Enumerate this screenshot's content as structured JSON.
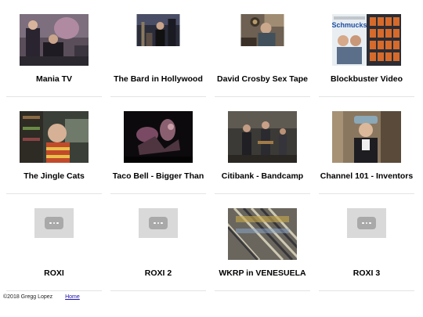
{
  "videos": [
    {
      "title": "Mania TV",
      "thumb": "photo"
    },
    {
      "title": "The Bard in Hollywood",
      "thumb": "photo"
    },
    {
      "title": "David Crosby Sex Tape",
      "thumb": "photo"
    },
    {
      "title": "Blockbuster Video",
      "thumb": "photo"
    },
    {
      "title": "The Jingle Cats",
      "thumb": "photo"
    },
    {
      "title": "Taco Bell - Bigger Than",
      "thumb": "photo"
    },
    {
      "title": "Citibank - Bandcamp",
      "thumb": "photo"
    },
    {
      "title": "Channel 101 - Inventors",
      "thumb": "photo"
    },
    {
      "title": "ROXI",
      "thumb": "placeholder"
    },
    {
      "title": "ROXI 2",
      "thumb": "placeholder"
    },
    {
      "title": "WKRP in VENESUELA",
      "thumb": "photo"
    },
    {
      "title": "ROXI 3",
      "thumb": "placeholder"
    }
  ],
  "blockbuster_poster_text": "Schmucks",
  "footer": {
    "copyright": "©2018 Gregg Lopez",
    "home_link": "Home"
  },
  "colors": {
    "separator": "#e4e4e4",
    "placeholder_bg": "#d9d9d9",
    "placeholder_icon": "#a9a9a9",
    "link": "#1a0dab"
  }
}
